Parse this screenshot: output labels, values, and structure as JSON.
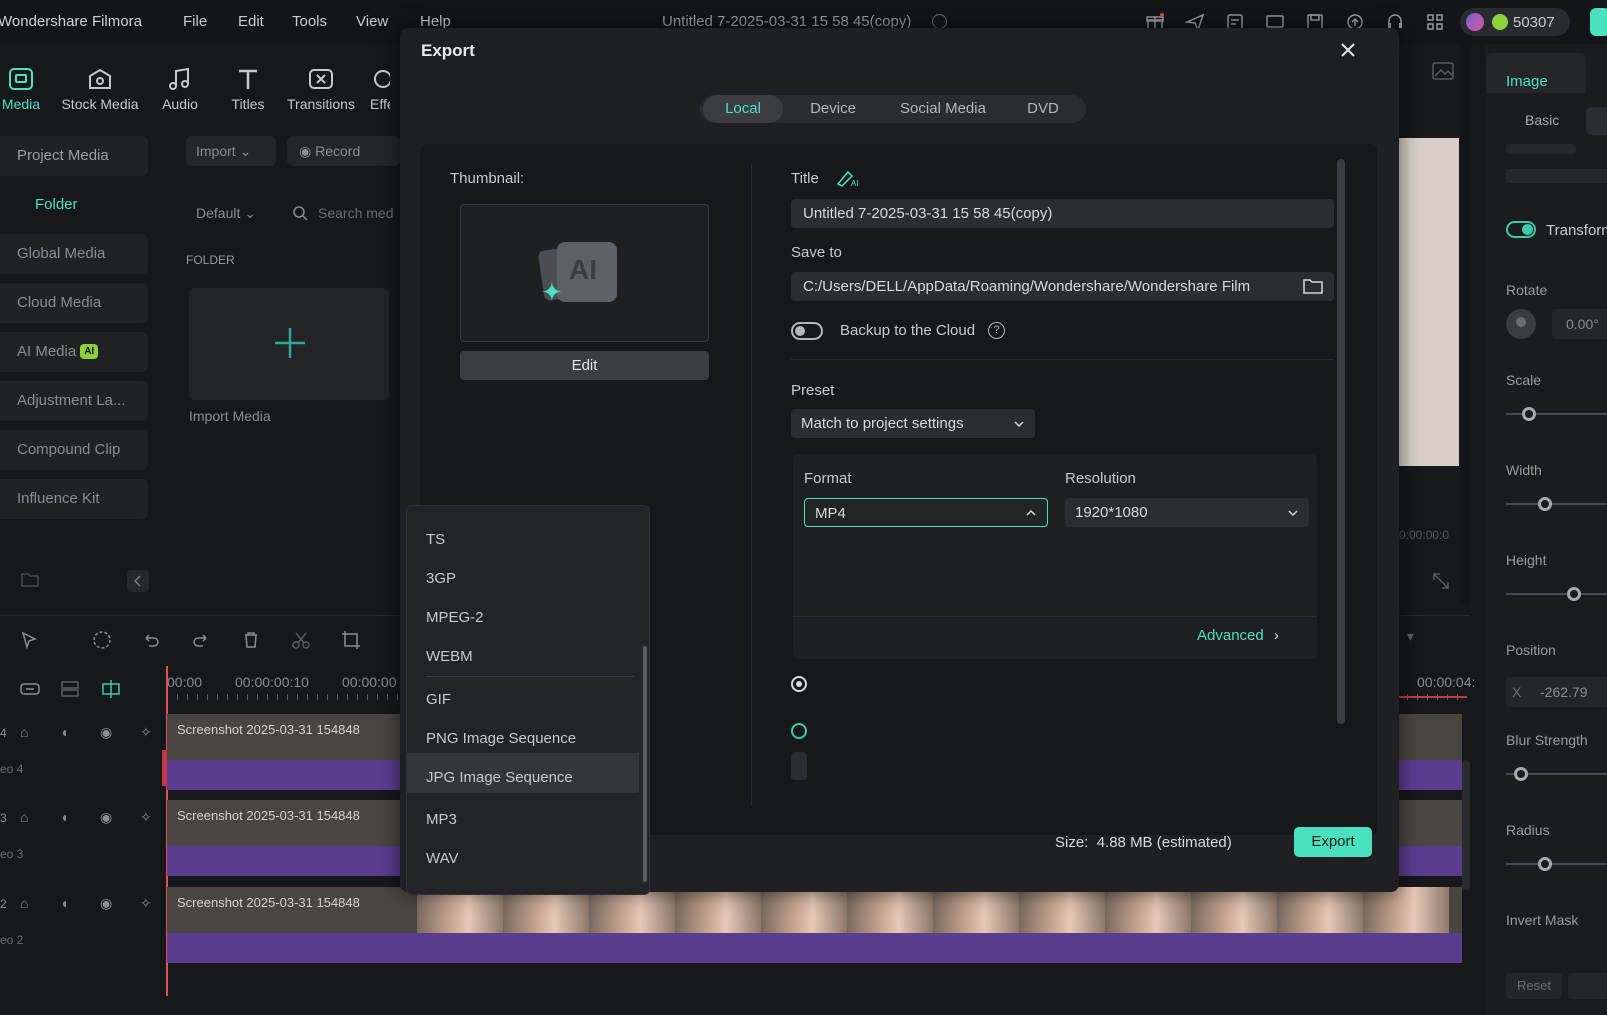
{
  "app": {
    "name": "Wondershare Filmora",
    "menu": [
      "File",
      "Edit",
      "Tools",
      "View",
      "Help"
    ],
    "document_title": "Untitled 7-2025-03-31 15 58 45(copy)",
    "credits": "50307"
  },
  "toolbar": {
    "items": [
      {
        "label": "Media",
        "icon": "media-icon"
      },
      {
        "label": "Stock Media",
        "icon": "stock-media-icon"
      },
      {
        "label": "Audio",
        "icon": "music-note-icon"
      },
      {
        "label": "Titles",
        "icon": "titles-icon"
      },
      {
        "label": "Transitions",
        "icon": "transitions-icon"
      },
      {
        "label": "Effe",
        "icon": "effects-icon"
      }
    ]
  },
  "sidebar": {
    "items": [
      "Project Media",
      "Folder",
      "Global Media",
      "Cloud Media",
      "AI Media",
      "Adjustment La...",
      "Compound Clip",
      "Influence Kit"
    ],
    "ai_badge": "AI"
  },
  "media": {
    "import_label": "Import",
    "record_label": "Record",
    "sort_label": "Default",
    "search_placeholder": "Search med",
    "folder_heading": "FOLDER",
    "import_media_label": "Import Media"
  },
  "timeline": {
    "time_0": "00:00",
    "time_1": "00:00:00:10",
    "time_2": "00:00:00",
    "time_end": "00:00:04:",
    "clip_label": "Screenshot 2025-03-31 154848",
    "track_names": [
      "eo 4",
      "eo 3",
      "eo 2"
    ],
    "track_numbers": [
      "4",
      "3",
      "2"
    ]
  },
  "right_panel": {
    "tab": "Image",
    "subtab": "Basic",
    "transform_label": "Transform",
    "rotate_label": "Rotate",
    "rotate_value": "0.00°",
    "scale_label": "Scale",
    "width_label": "Width",
    "height_label": "Height",
    "position_label": "Position",
    "x_label": "X",
    "x_value": "-262.79",
    "blur_label": "Blur Strength",
    "radius_label": "Radius",
    "invert_label": "Invert Mask",
    "reset_label": "Reset",
    "preview_time": "0:00:00:0"
  },
  "export": {
    "title": "Export",
    "tabs": [
      "Local",
      "Device",
      "Social Media",
      "DVD"
    ],
    "active_tab": "Local",
    "thumbnail_label": "Thumbnail:",
    "thumbnail_ai_text": "AI",
    "edit_label": "Edit",
    "title_label": "Title",
    "title_value": "Untitled 7-2025-03-31 15 58 45(copy)",
    "save_to_label": "Save to",
    "save_to_value": "C:/Users/DELL/AppData/Roaming/Wondershare/Wondershare Film",
    "backup_label": "Backup to the Cloud",
    "preset_label": "Preset",
    "preset_value": "Match to project settings",
    "format_label": "Format",
    "format_value": "MP4",
    "resolution_label": "Resolution",
    "resolution_value": "1920*1080",
    "advanced_label": "Advanced",
    "size_label": "Size:",
    "size_value": "4.88 MB (estimated)",
    "export_button": "Export",
    "format_options": [
      "TS",
      "3GP",
      "MPEG-2",
      "WEBM",
      "GIF",
      "PNG Image Sequence",
      "JPG Image Sequence",
      "MP3",
      "WAV"
    ],
    "highlighted_option": "JPG Image Sequence",
    "accent_color": "#4ae1be"
  }
}
